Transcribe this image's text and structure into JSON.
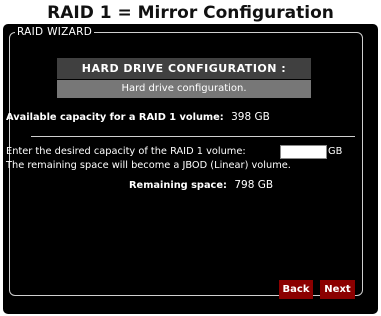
{
  "caption": "RAID 1 = Mirror Configuration",
  "wizard": {
    "legend": "RAID WIZARD",
    "header_title": "HARD DRIVE CONFIGURATION :",
    "header_subtitle": "Hard drive configuration.",
    "available_label": "Available capacity for a RAID 1 volume:",
    "available_value": "398 GB",
    "capacity_prompt": "Enter the desired capacity of the RAID 1 volume:",
    "capacity_input_value": "",
    "capacity_unit": "GB",
    "remaining_note": "The remaining space will become a JBOD (Linear) volume.",
    "remaining_label": "Remaining space:",
    "remaining_value": "798 GB",
    "back_label": "Back",
    "next_label": "Next",
    "button_color": "#8b0000"
  }
}
